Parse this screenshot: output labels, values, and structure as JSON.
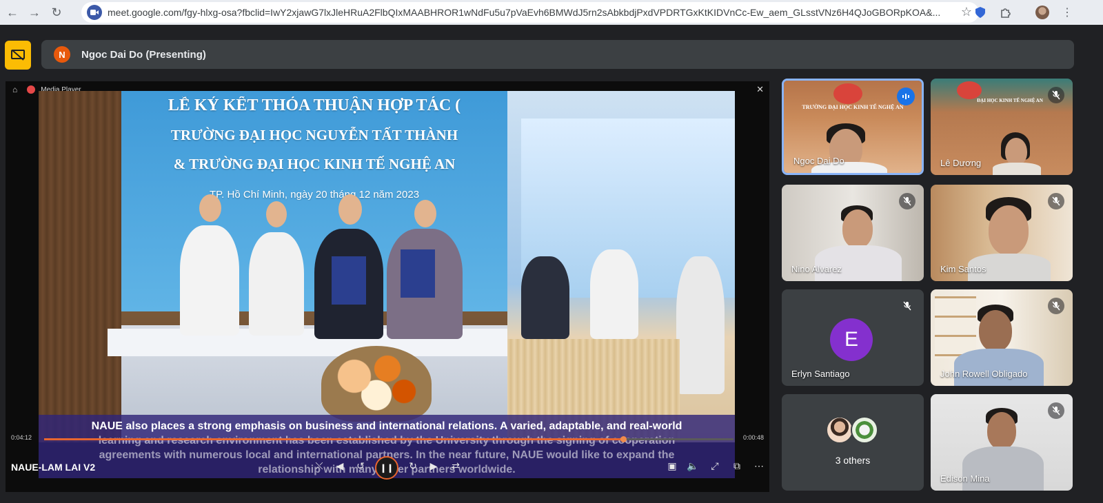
{
  "browser": {
    "url": "meet.google.com/fgy-hlxg-osa?fbclid=IwY2xjawG7lxJleHRuA2FlbQIxMAABHROR1wNdFu5u7pVaEvh6BMWdJ5rn2sAbkbdjPxdVPDRTGxKtKIDVnCc-Ew_aem_GLsstVNz6H4QJoGBORpKOA&..."
  },
  "meeting": {
    "presenter_initial": "N",
    "presenter_label": "Ngoc Dai Do (Presenting)"
  },
  "media_player": {
    "app_title": "Media Player",
    "video_title": "NAUE-LAM LAI V2",
    "time_elapsed": "0:04:12",
    "time_remaining": "0:00:48",
    "progress": 0.84,
    "banner": {
      "line1": "LỄ KÝ KẾT THỎA THUẬN HỢP TÁC (",
      "line2": "TRƯỜNG ĐẠI HỌC NGUYỄN TẤT THÀNH",
      "line3": "& TRƯỜNG ĐẠI HỌC KINH TẾ NGHỆ AN",
      "line4": "TP. Hồ Chí Minh, ngày 20 tháng 12 năm 2023"
    },
    "caption": {
      "line1": "NAUE also places a strong emphasis on business and international relations. A varied, adaptable, and real-world",
      "line2": "learning and research environment has been established by the University through the signing of cooperation",
      "line3": "agreements with numerous local and international partners. In the near future, NAUE would like to expand the",
      "line4": "relationship with many other partners worldwide."
    }
  },
  "participants": [
    {
      "name": "Ngoc Dai Do",
      "state": "speaking",
      "sign": "TRƯỜNG ĐẠI HỌC KINH TẾ NGHỆ AN"
    },
    {
      "name": "Lê Dương",
      "state": "muted",
      "sign": "ĐẠI HỌC KINH TẾ NGHỆ AN"
    },
    {
      "name": "Nino Alvarez",
      "state": "muted"
    },
    {
      "name": "Kim Santos",
      "state": "muted"
    },
    {
      "name": "Erlyn Santiago",
      "state": "muted",
      "initial": "E"
    },
    {
      "name": "John Rowell Obligado",
      "state": "muted"
    },
    {
      "name": "3 others",
      "state": "group"
    },
    {
      "name": "Edison Mina",
      "state": "muted"
    }
  ],
  "colors": {
    "meet_bg": "#202124",
    "tile_bg": "#3c4043",
    "active_border": "#8ab4f8",
    "present_yellow": "#fbbc04",
    "progress_orange": "#e8662f",
    "avatar_purple": "#8430ce"
  }
}
